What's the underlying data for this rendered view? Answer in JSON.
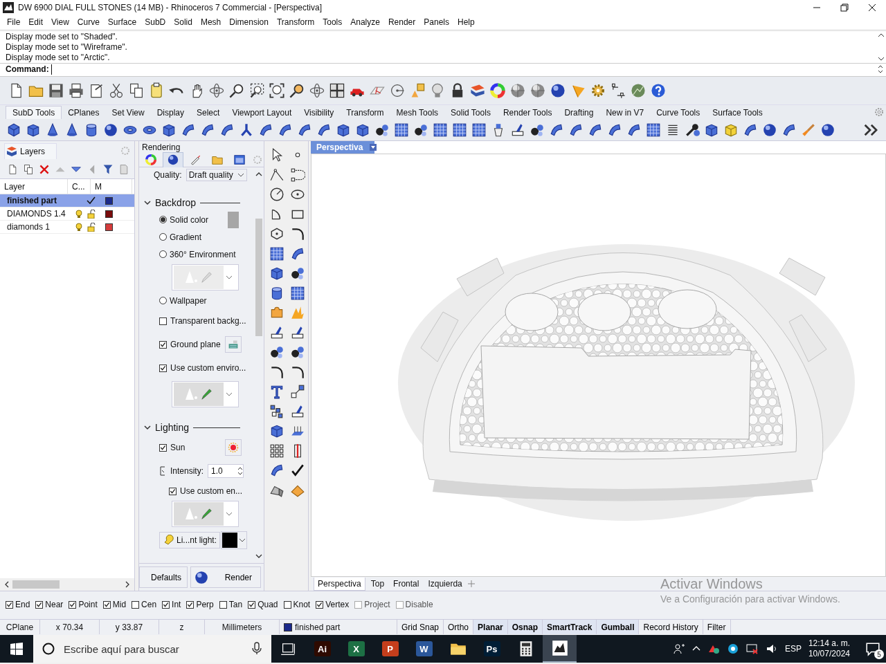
{
  "window": {
    "title": "DW 6900 DIAL FULL STONES (14 MB) - Rhinoceros 7 Commercial - [Perspectiva]"
  },
  "menu": [
    "File",
    "Edit",
    "View",
    "Curve",
    "Surface",
    "SubD",
    "Solid",
    "Mesh",
    "Dimension",
    "Transform",
    "Tools",
    "Analyze",
    "Render",
    "Panels",
    "Help"
  ],
  "command_history": [
    "Display mode set to \"Shaded\".",
    "Display mode set to \"Wireframe\".",
    "Display mode set to \"Arctic\"."
  ],
  "command_prompt": {
    "label": "Command:"
  },
  "toolbar_tabs": [
    {
      "label": "SubD Tools",
      "selected": true
    },
    {
      "label": "CPlanes",
      "selected": false
    },
    {
      "label": "Set View",
      "selected": false
    },
    {
      "label": "Display",
      "selected": false
    },
    {
      "label": "Select",
      "selected": false
    },
    {
      "label": "Viewport Layout",
      "selected": false
    },
    {
      "label": "Visibility",
      "selected": false
    },
    {
      "label": "Transform",
      "selected": false
    },
    {
      "label": "Mesh Tools",
      "selected": false
    },
    {
      "label": "Solid Tools",
      "selected": false
    },
    {
      "label": "Render Tools",
      "selected": false
    },
    {
      "label": "Drafting",
      "selected": false
    },
    {
      "label": "New in V7",
      "selected": false
    },
    {
      "label": "Curve Tools",
      "selected": false
    },
    {
      "label": "Surface Tools",
      "selected": false
    }
  ],
  "layers_panel": {
    "title": "Layers",
    "columns": [
      "Layer",
      "C...",
      "M"
    ],
    "rows": [
      {
        "name": "finished part",
        "selected": true,
        "current": true,
        "color": "#1c2a8a"
      },
      {
        "name": "DIAMONDS 1.4",
        "selected": false,
        "current": false,
        "color": "#7a0c0c"
      },
      {
        "name": "diamonds 1",
        "selected": false,
        "current": false,
        "color": "#d43c3c"
      }
    ]
  },
  "rendering_panel": {
    "title": "Rendering",
    "tabs": [
      {
        "kind": "colors",
        "selected": false
      },
      {
        "kind": "sphere",
        "selected": true
      },
      {
        "kind": "tube",
        "selected": false
      },
      {
        "kind": "folder",
        "selected": false
      },
      {
        "kind": "window",
        "selected": false
      }
    ],
    "quality_label": "Quality:",
    "quality_value": "Draft quality",
    "rows": [
      {
        "kind": "heading",
        "label": "Backdrop",
        "expanded": true
      },
      {
        "kind": "radio",
        "label": "Solid color",
        "selected": true,
        "color": "#a6a6a6"
      },
      {
        "kind": "radio",
        "label": "Gradient",
        "selected": false
      },
      {
        "kind": "radio",
        "label": "360° Environment",
        "selected": false
      },
      {
        "kind": "thumbnail",
        "disabled": true
      },
      {
        "kind": "radio",
        "label": "Wallpaper",
        "selected": false
      },
      {
        "kind": "checkbox",
        "label": "Transparent backg...",
        "checked": false
      },
      {
        "kind": "checkbox",
        "label": "Ground plane",
        "checked": true,
        "button": {
          "kind": "ground"
        }
      },
      {
        "kind": "checkbox",
        "label": "Use custom enviro...",
        "checked": true
      },
      {
        "kind": "thumbnail",
        "disabled": false
      },
      {
        "kind": "heading",
        "label": "Lighting",
        "expanded": true
      },
      {
        "kind": "checkbox",
        "label": "Sun",
        "checked": true,
        "button": {
          "kind": "sun"
        }
      },
      {
        "kind": "spinner",
        "label": "Intensity:",
        "value": "1.0",
        "children": [
          {
            "kind": "checkbox",
            "label": "Use custom en...",
            "checked": true
          },
          {
            "kind": "thumbnail",
            "disabled": false
          }
        ]
      },
      {
        "kind": "ambient",
        "label": "Li...nt light:",
        "color": "#000000"
      }
    ],
    "buttons": [
      "Defaults",
      "Render"
    ]
  },
  "viewport": {
    "title": "Perspectiva",
    "tabs": [
      {
        "label": "Perspectiva",
        "selected": true
      },
      {
        "label": "Top",
        "selected": false
      },
      {
        "label": "Frontal",
        "selected": false
      },
      {
        "label": "Izquierda",
        "selected": false
      }
    ]
  },
  "activation_notice": {
    "title": "Activar Windows",
    "text": "Ve a Configuración para activar Windows."
  },
  "osnaps": [
    {
      "label": "End",
      "checked": true,
      "disabled": false
    },
    {
      "label": "Near",
      "checked": true,
      "disabled": false
    },
    {
      "label": "Point",
      "checked": true,
      "disabled": false
    },
    {
      "label": "Mid",
      "checked": true,
      "disabled": false
    },
    {
      "label": "Cen",
      "checked": false,
      "disabled": false
    },
    {
      "label": "Int",
      "checked": true,
      "disabled": false
    },
    {
      "label": "Perp",
      "checked": true,
      "disabled": false
    },
    {
      "label": "Tan",
      "checked": false,
      "disabled": false
    },
    {
      "label": "Quad",
      "checked": true,
      "disabled": false
    },
    {
      "label": "Knot",
      "checked": false,
      "disabled": false
    },
    {
      "label": "Vertex",
      "checked": true,
      "disabled": false
    },
    {
      "label": "Project",
      "checked": false,
      "disabled": true
    },
    {
      "label": "Disable",
      "checked": false,
      "disabled": true
    }
  ],
  "status_bar": {
    "fields": [
      {
        "kind": "text",
        "label": "CPlane"
      },
      {
        "kind": "text",
        "label": "x 70.34"
      },
      {
        "kind": "text",
        "label": "y 33.87"
      },
      {
        "kind": "text",
        "label": "z"
      },
      {
        "kind": "text",
        "label": "Millimeters"
      },
      {
        "kind": "layer",
        "label": "finished part",
        "color": "#1c2a8a"
      }
    ],
    "toggles": [
      {
        "label": "Grid Snap",
        "on": false
      },
      {
        "label": "Ortho",
        "on": false
      },
      {
        "label": "Planar",
        "on": true
      },
      {
        "label": "Osnap",
        "on": true
      },
      {
        "label": "SmartTrack",
        "on": true
      },
      {
        "label": "Gumball",
        "on": true
      },
      {
        "label": "Record History",
        "on": false
      },
      {
        "label": "Filter",
        "on": false
      }
    ]
  },
  "taskbar": {
    "search_placeholder": "Escribe aquí para buscar",
    "apps": [
      {
        "kind": "taskview",
        "active": false
      },
      {
        "kind": "letter",
        "label": "Ai",
        "color": "#2e0a00",
        "active": false
      },
      {
        "kind": "letter",
        "label": "X",
        "color": "#1d7044",
        "active": false
      },
      {
        "kind": "letter",
        "label": "P",
        "color": "#c43e1c",
        "active": false
      },
      {
        "kind": "letter",
        "label": "W",
        "color": "#2b579a",
        "active": false
      },
      {
        "kind": "folder",
        "active": false
      },
      {
        "kind": "letter",
        "label": "Ps",
        "color": "#001e36",
        "active": false
      },
      {
        "kind": "calculator",
        "active": false
      },
      {
        "kind": "rhino",
        "active": true
      }
    ],
    "language": "ESP",
    "time": "12:14 a. m.",
    "date": "10/07/2024",
    "notifications": "5"
  }
}
